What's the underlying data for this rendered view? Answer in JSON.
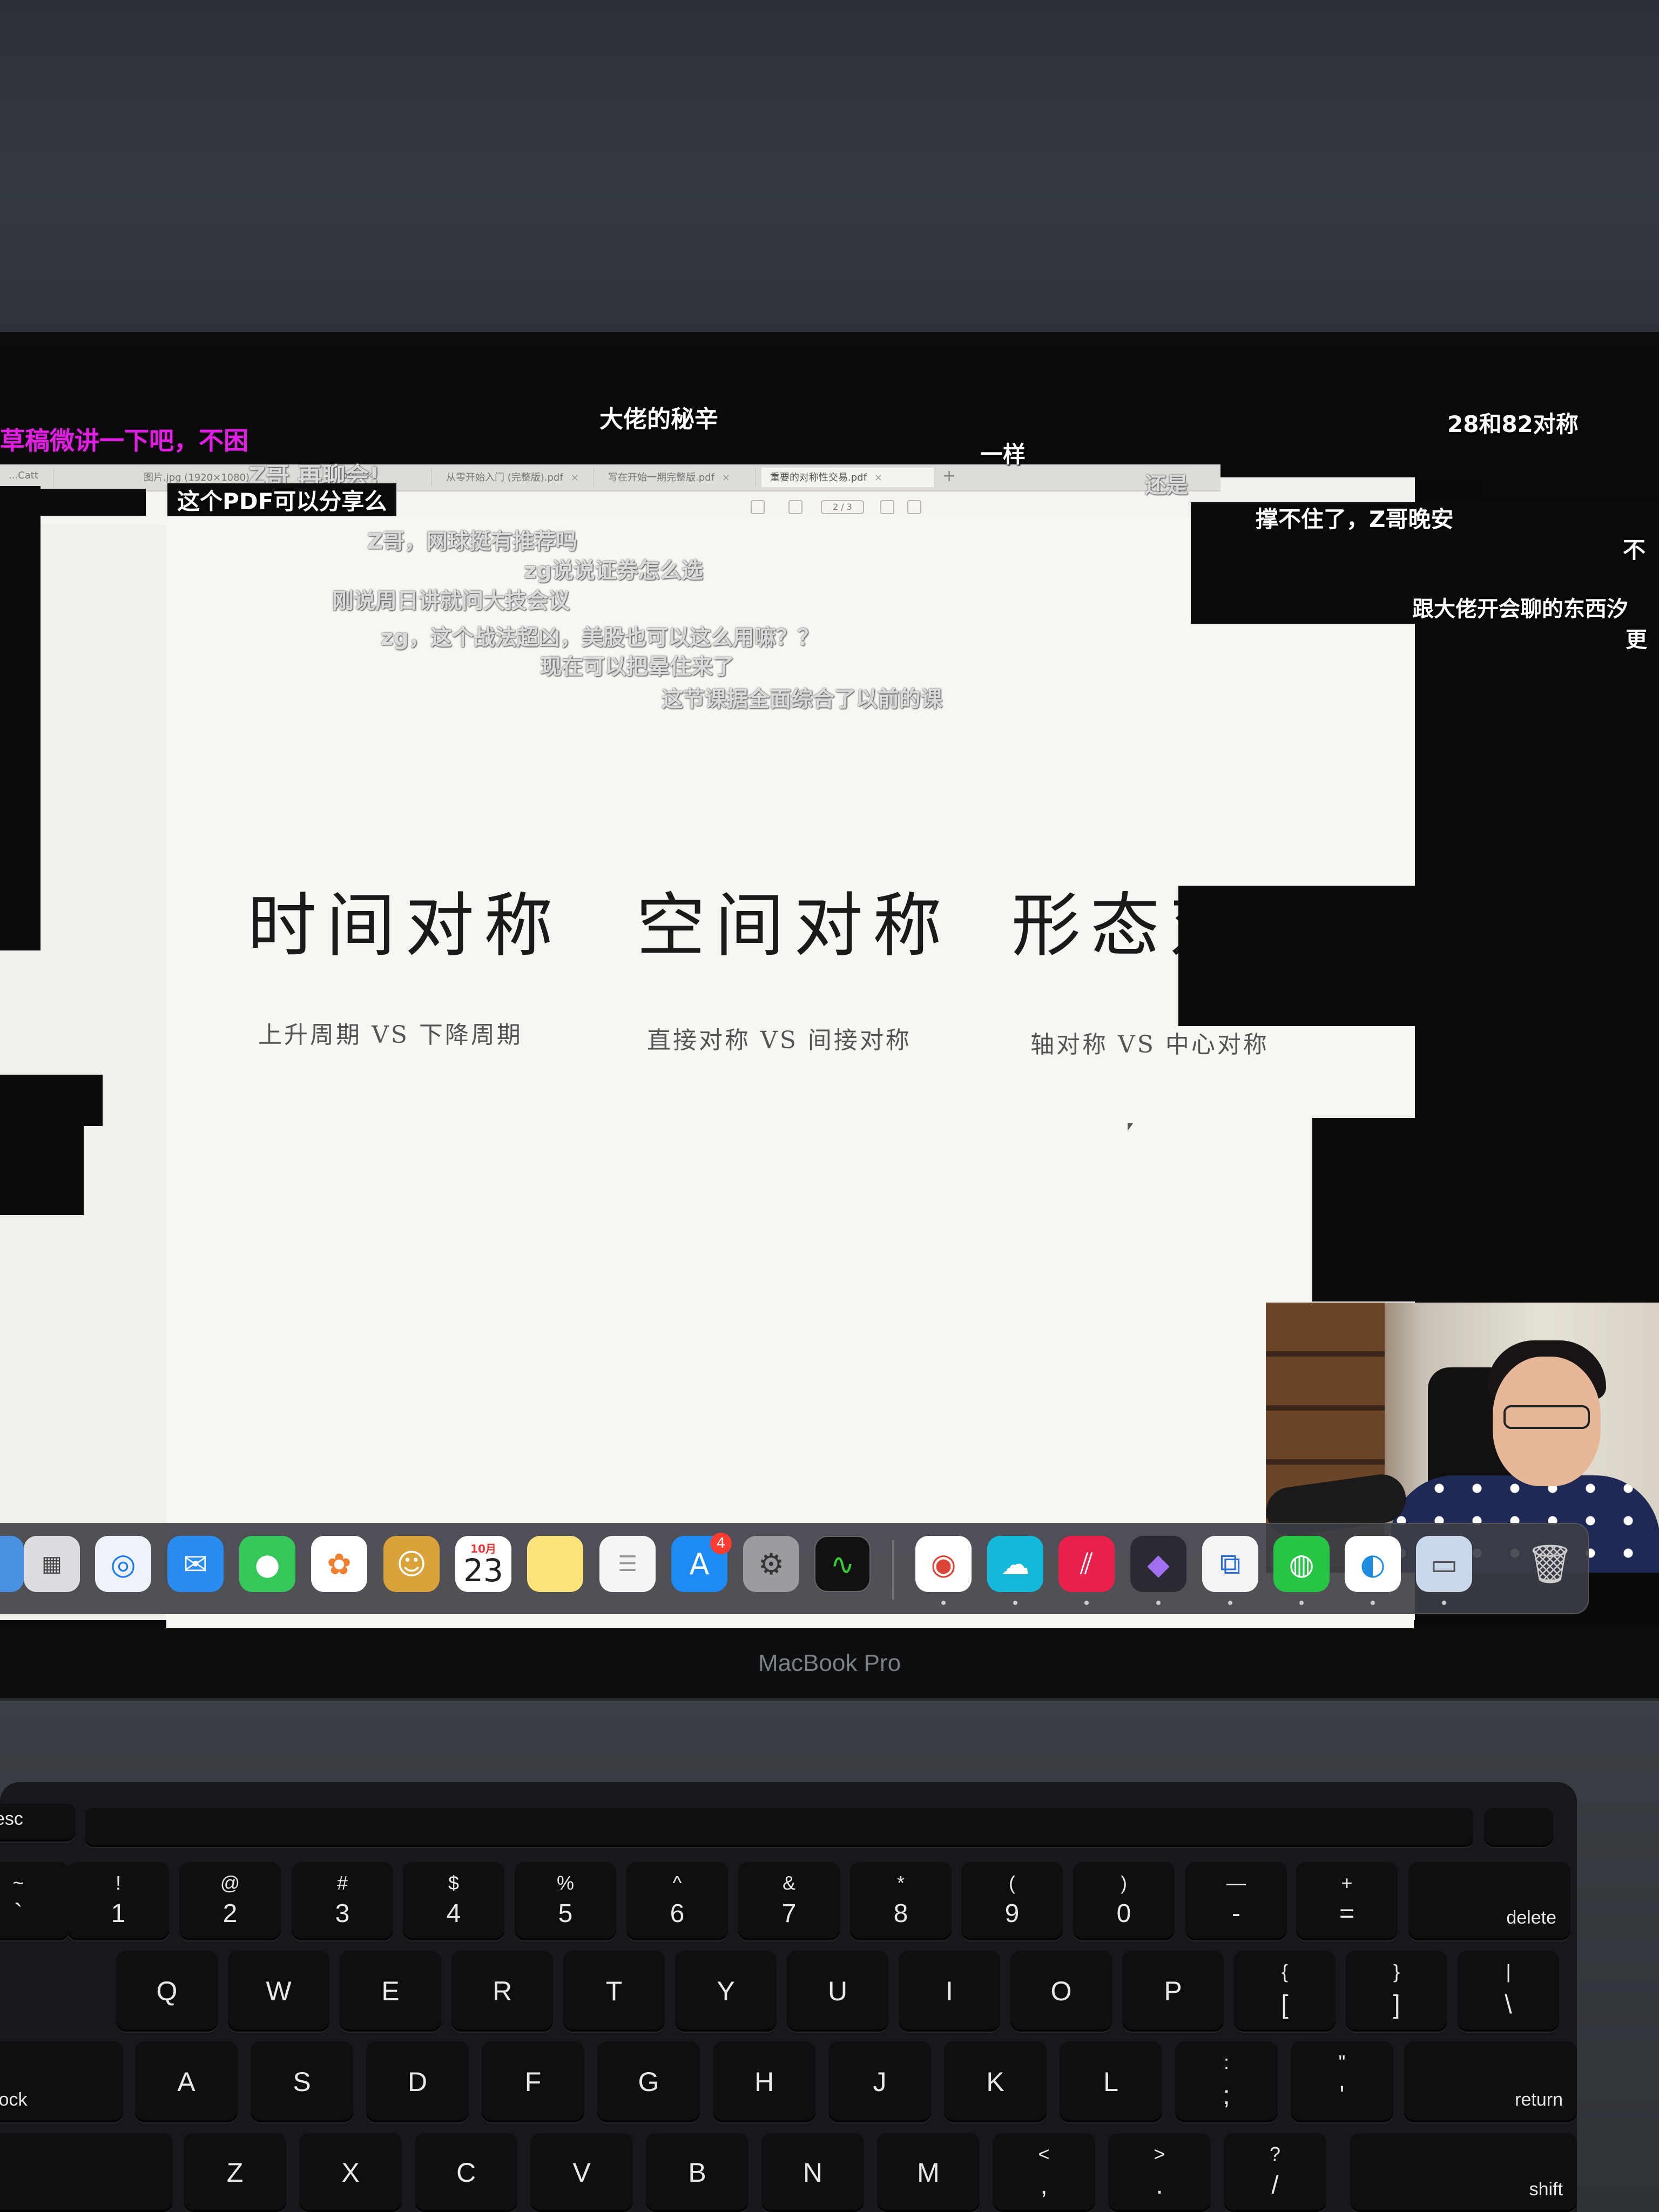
{
  "pdf_viewer": {
    "tabs": [
      {
        "label": "...Catt",
        "active": false
      },
      {
        "label": "图片.jpg (1920×1080)",
        "active": false
      },
      {
        "label": "...pdf",
        "active": false
      },
      {
        "label": "从零开始入门 (完整版).pdf",
        "active": false
      },
      {
        "label": "写在开始一期完整版.pdf",
        "active": false
      },
      {
        "label": "重要的对称性交易.pdf",
        "active": true
      }
    ],
    "page_info": "2 / 3",
    "headings": [
      "时间对称",
      "空间对称",
      "形态对称"
    ],
    "subheadings": [
      "上升周期 VS 下降周期",
      "直接对称 VS 间接对称",
      "轴对称 VS 中心对称"
    ]
  },
  "danmaku": [
    "草稿微讲一下吧，不困",
    "大佬的秘辛",
    "28和82对称",
    "Z哥 再聊会!",
    "一样",
    "这个PDF可以分享么",
    "还是",
    "撑不住了，Z哥晚安",
    "不",
    "Z哥，网球挺有推荐吗",
    "zg说说证券怎么选",
    "跟大佬开会聊的东西汐",
    "刚说周日讲就问大技会议",
    "zg，这个战法超凶，美股也可以这么用嘛？？",
    "更",
    "现在可以把晕住来了",
    "这节课据全面综合了以前的课"
  ],
  "dock": {
    "calendar_month": "10月",
    "calendar_day": "23",
    "app_store_badge": "4",
    "apps": [
      "Finder",
      "Launchpad",
      "Safari",
      "Mail",
      "Messages",
      "Photos",
      "Contacts",
      "Calendar",
      "Notes",
      "Reminders",
      "App Store",
      "System Settings",
      "Activity Monitor",
      "Google Chrome",
      "iCloud",
      "Parallels",
      "Obsidian",
      "Remote Desktop",
      "WeChat",
      "Microsoft Edge",
      "Preview",
      "Trash"
    ]
  },
  "laptop_brand": "MacBook Pro",
  "keyboard": {
    "fn_row": [
      "esc"
    ],
    "number_row": [
      {
        "top": "~",
        "bot": "`"
      },
      {
        "top": "!",
        "bot": "1"
      },
      {
        "top": "@",
        "bot": "2"
      },
      {
        "top": "#",
        "bot": "3"
      },
      {
        "top": "$",
        "bot": "4"
      },
      {
        "top": "%",
        "bot": "5"
      },
      {
        "top": "^",
        "bot": "6"
      },
      {
        "top": "&",
        "bot": "7"
      },
      {
        "top": "*",
        "bot": "8"
      },
      {
        "top": "(",
        "bot": "9"
      },
      {
        "top": ")",
        "bot": "0"
      },
      {
        "top": "—",
        "bot": "-"
      },
      {
        "top": "+",
        "bot": "="
      }
    ],
    "delete_label": "delete",
    "qwerty_row": [
      "Q",
      "W",
      "E",
      "R",
      "T",
      "Y",
      "U",
      "I",
      "O",
      "P"
    ],
    "qwerty_extra": [
      {
        "top": "{",
        "bot": "["
      },
      {
        "top": "}",
        "bot": "]"
      },
      {
        "top": "|",
        "bot": "\\"
      }
    ],
    "home_row": [
      "A",
      "S",
      "D",
      "F",
      "G",
      "H",
      "J",
      "K",
      "L"
    ],
    "home_extra": [
      {
        "top": ":",
        "bot": ";"
      },
      {
        "top": "\"",
        "bot": "'"
      }
    ],
    "caps_label": "lock",
    "return_label": "return",
    "bottom_row": [
      "Z",
      "X",
      "C",
      "V",
      "B",
      "N",
      "M"
    ],
    "bottom_extra": [
      {
        "top": "<",
        "bot": ","
      },
      {
        "top": ">",
        "bot": "."
      },
      {
        "top": "?",
        "bot": "/"
      }
    ],
    "shift_label": "shift"
  },
  "colors": {
    "danmaku_highlight": "#e020e0",
    "page_bg": "#f7f6f2",
    "screen_black": "#0b0b0b",
    "badge": "#ff3b30"
  }
}
